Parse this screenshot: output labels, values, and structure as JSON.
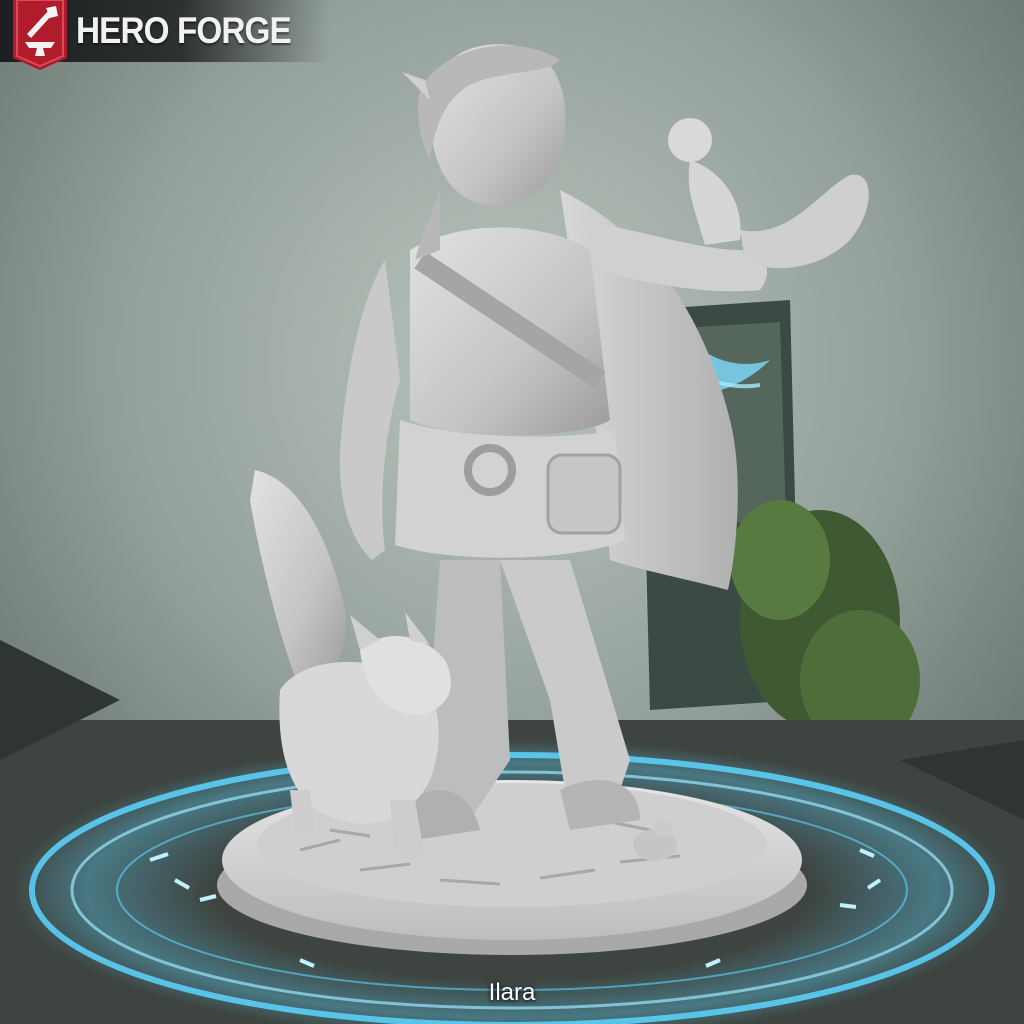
{
  "brand": {
    "name": "HERO FORGE",
    "accent_color": "#b01c2c",
    "badge_icon": "anvil-hammer-icon"
  },
  "miniature": {
    "name": "Ilara",
    "material": "unpainted-grey",
    "companions": [
      "fox",
      "squirrel",
      "mouse"
    ]
  },
  "scene": {
    "base_glow_color": "#5cd6ff",
    "background_color": "#8a9590"
  }
}
